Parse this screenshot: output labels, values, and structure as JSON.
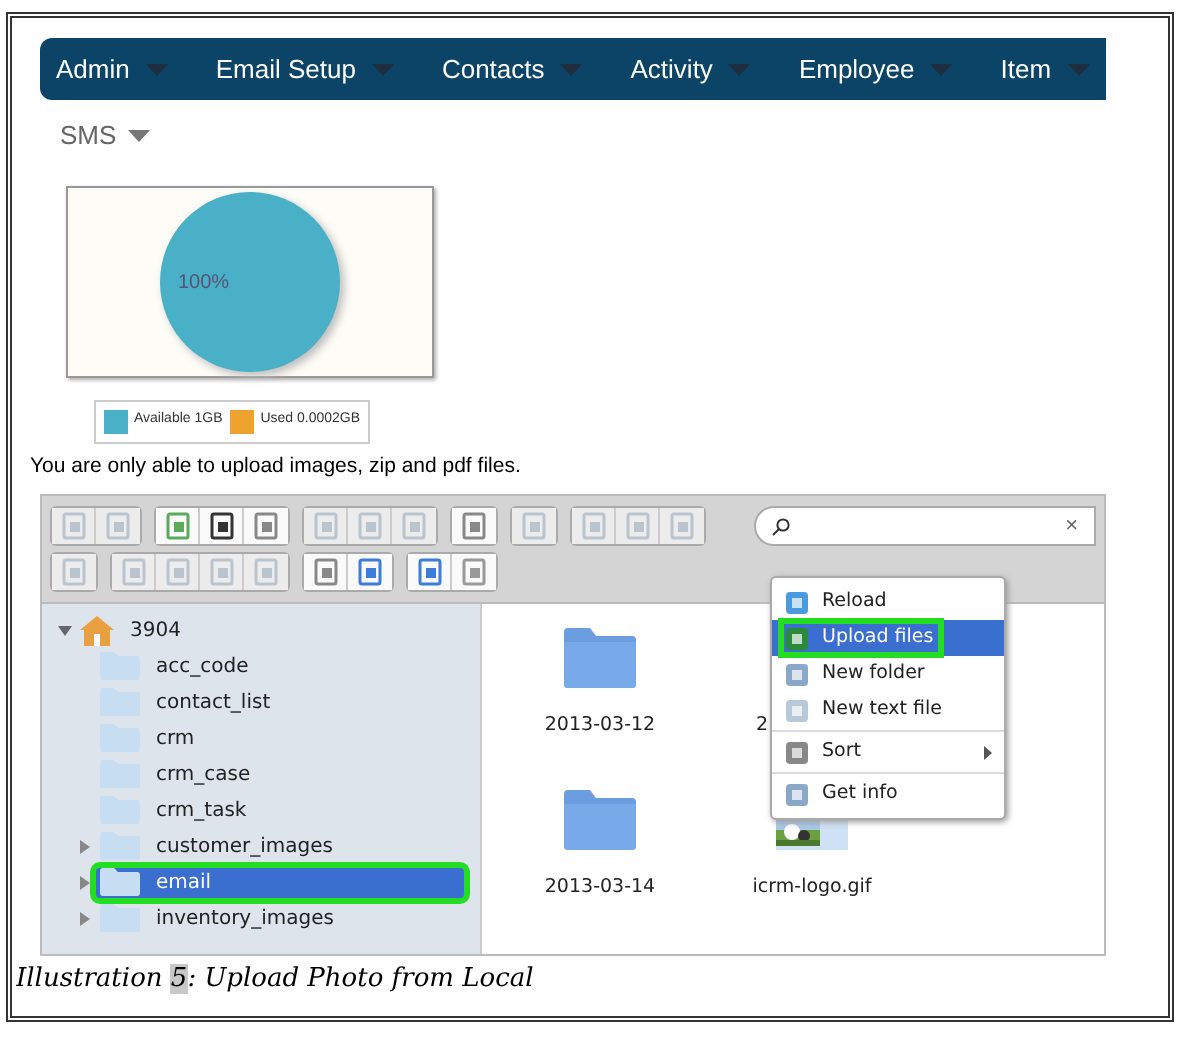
{
  "nav": [
    {
      "label": "Admin"
    },
    {
      "label": "Email Setup"
    },
    {
      "label": "Contacts"
    },
    {
      "label": "Activity"
    },
    {
      "label": "Employee"
    },
    {
      "label": "Item"
    },
    {
      "label": "SMS"
    }
  ],
  "storage_chart": {
    "slice_label": "100%",
    "legend": [
      {
        "label": "Available 1GB",
        "color": "#4ab0c8"
      },
      {
        "label": "Used 0.0002GB",
        "color": "#f0a22e"
      }
    ]
  },
  "notice": "You are only able to upload images, zip and pdf files.",
  "file_manager": {
    "toolbar": [
      [
        [
          {
            "disabled": true
          },
          {
            "disabled": true
          }
        ],
        [
          {
            "disabled": false
          },
          {
            "disabled": false
          },
          {
            "disabled": false
          }
        ],
        [
          {
            "disabled": true
          },
          {
            "disabled": true
          },
          {
            "disabled": true
          }
        ],
        [
          {
            "disabled": false
          }
        ],
        [
          {
            "disabled": true
          }
        ],
        [
          {
            "disabled": true
          },
          {
            "disabled": true
          },
          {
            "disabled": true
          }
        ]
      ],
      [
        [
          {
            "disabled": true
          }
        ],
        [
          {
            "disabled": true
          },
          {
            "disabled": true
          },
          {
            "disabled": true
          },
          {
            "disabled": true
          }
        ],
        [
          {
            "disabled": false
          },
          {
            "disabled": false
          }
        ],
        [
          {
            "disabled": false
          },
          {
            "disabled": false
          }
        ]
      ]
    ],
    "search": {
      "clear": "×"
    },
    "tree": [
      {
        "label": "3904",
        "expanded": true,
        "selected": false,
        "highlighted": false,
        "children": [
          {
            "label": "acc_code",
            "selected": false,
            "highlighted": false
          },
          {
            "label": "contact_list",
            "selected": false,
            "highlighted": false
          },
          {
            "label": "crm",
            "selected": false,
            "highlighted": false
          },
          {
            "label": "crm_case",
            "selected": false,
            "highlighted": false
          },
          {
            "label": "crm_task",
            "selected": false,
            "highlighted": false
          },
          {
            "label": "customer_images",
            "expanded": false,
            "selected": false,
            "highlighted": false
          },
          {
            "label": "email",
            "expanded": false,
            "selected": true,
            "highlighted": true
          },
          {
            "label": "inventory_images",
            "expanded": false,
            "selected": false,
            "highlighted": false
          }
        ]
      }
    ],
    "files": [
      {
        "kind": "folder",
        "label": "2013-03-12"
      },
      {
        "kind": "covered",
        "label": "2"
      },
      {
        "kind": "folder",
        "label": "2013-03-14"
      },
      {
        "kind": "picture",
        "label": "icrm-logo.gif"
      }
    ],
    "context_menu": [
      [
        {
          "kind": "action",
          "label": "Reload",
          "selected": false,
          "highlighted": false
        },
        {
          "kind": "action",
          "label": "Upload files",
          "selected": true,
          "highlighted": true
        },
        {
          "kind": "action",
          "label": "New folder",
          "selected": false,
          "highlighted": false
        },
        {
          "kind": "action",
          "label": "New text file",
          "selected": false,
          "highlighted": false
        }
      ],
      [
        {
          "kind": "submenu",
          "label": "Sort",
          "selected": false,
          "highlighted": false
        }
      ],
      [
        {
          "kind": "action",
          "label": "Get info",
          "selected": false,
          "highlighted": false
        }
      ]
    ]
  },
  "caption": {
    "label": "Illustration ",
    "number": "5",
    "text": ": Upload Photo from Local"
  }
}
